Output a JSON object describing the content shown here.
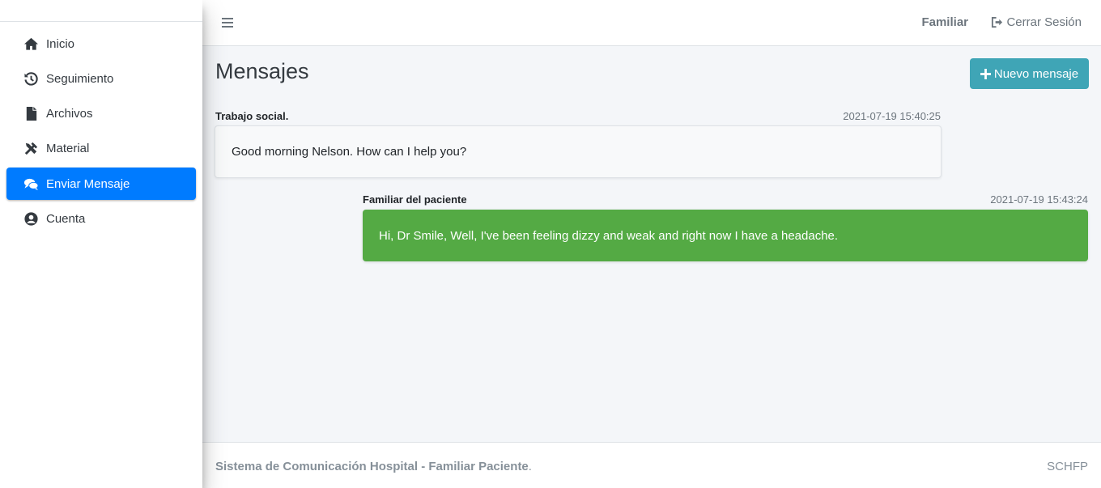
{
  "sidebar": {
    "items": [
      {
        "label": "Inicio",
        "icon": "home-icon"
      },
      {
        "label": "Seguimiento",
        "icon": "history-icon"
      },
      {
        "label": "Archivos",
        "icon": "file-icon"
      },
      {
        "label": "Material",
        "icon": "tools-icon"
      },
      {
        "label": "Enviar Mensaje",
        "icon": "comments-icon",
        "active": true
      },
      {
        "label": "Cuenta",
        "icon": "user-circle-icon"
      }
    ]
  },
  "topbar": {
    "menu_icon": "hamburger-icon",
    "user_role": "Familiar",
    "logout_label": "Cerrar Sesión",
    "logout_icon": "sign-out-icon"
  },
  "main": {
    "title": "Mensajes",
    "new_message_label": "Nuevo mensaje",
    "new_message_icon": "plus-icon",
    "messages": [
      {
        "sender": "Trabajo social.",
        "timestamp": "2021-07-19 15:40:25",
        "text": "Good morning Nelson. How can I help you?",
        "side": "left"
      },
      {
        "sender": "Familiar del paciente",
        "timestamp": "2021-07-19 15:43:24",
        "text": "Hi, Dr Smile, Well, I've been feeling dizzy and weak and right now I have a headache.",
        "side": "right"
      }
    ]
  },
  "footer": {
    "system_name": "Sistema de Comunicación Hospital - Familiar Paciente",
    "period": ".",
    "short_name": "SCHFP"
  },
  "colors": {
    "active_nav": "#007bff",
    "button": "#3fa5b6",
    "sent_message": "#54aa44"
  }
}
